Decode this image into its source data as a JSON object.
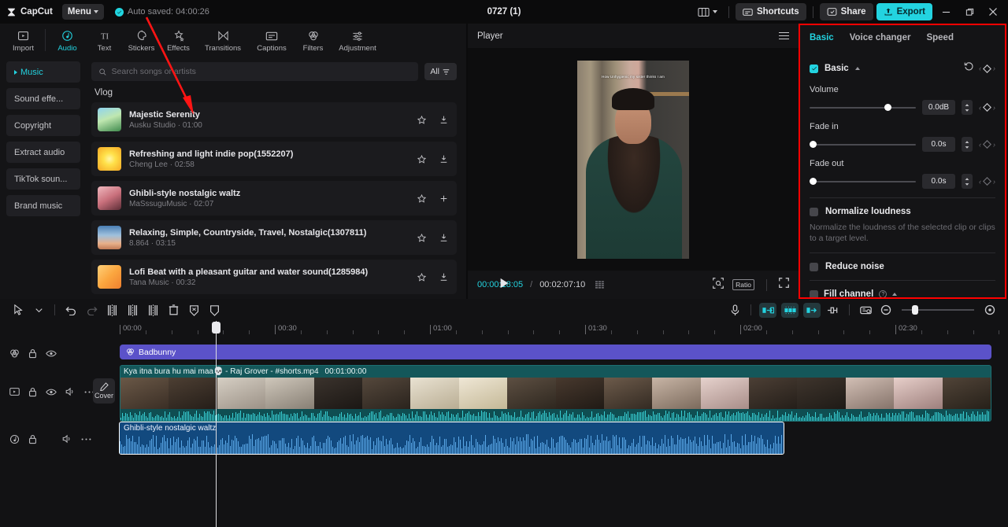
{
  "titlebar": {
    "brand": "CapCut",
    "menu_label": "Menu",
    "autosave": "Auto saved: 04:00:26",
    "project_title": "0727 (1)",
    "shortcuts_label": "Shortcuts",
    "share_label": "Share",
    "export_label": "Export",
    "accent": "#23d3e0"
  },
  "nav_tabs": [
    {
      "label": "Import",
      "icon": "import-icon",
      "active": false
    },
    {
      "label": "Audio",
      "icon": "audio-icon",
      "active": true
    },
    {
      "label": "Text",
      "icon": "text-icon",
      "active": false
    },
    {
      "label": "Stickers",
      "icon": "stickers-icon",
      "active": false
    },
    {
      "label": "Effects",
      "icon": "effects-icon",
      "active": false
    },
    {
      "label": "Transitions",
      "icon": "transitions-icon",
      "active": false
    },
    {
      "label": "Captions",
      "icon": "captions-icon",
      "active": false
    },
    {
      "label": "Filters",
      "icon": "filters-icon",
      "active": false
    },
    {
      "label": "Adjustment",
      "icon": "adjustment-icon",
      "active": false
    }
  ],
  "side_nav": [
    {
      "label": "Music",
      "active": true
    },
    {
      "label": "Sound effe...",
      "active": false
    },
    {
      "label": "Copyright",
      "active": false
    },
    {
      "label": "Extract audio",
      "active": false
    },
    {
      "label": "TikTok soun...",
      "active": false
    },
    {
      "label": "Brand music",
      "active": false
    }
  ],
  "search": {
    "placeholder": "Search songs or artists",
    "value": "",
    "filter_label": "All"
  },
  "music": {
    "section_title": "Vlog",
    "items": [
      {
        "title": "Majestic Serenity",
        "artist": "Ausku Studio",
        "duration": "01:00",
        "action": "download",
        "thumb_a": "#6fb3d9",
        "thumb_b": "#3f8a4d"
      },
      {
        "title": "Refreshing and light indie pop(1552207)",
        "artist": "Cheng Lee",
        "duration": "02:58",
        "action": "download",
        "thumb_a": "#ffe96a",
        "thumb_b": "#f5b324"
      },
      {
        "title": "Ghibli-style nostalgic waltz",
        "artist": "MaSssuguMusic",
        "duration": "02:07",
        "action": "add",
        "thumb_a": "#e4a1a8",
        "thumb_b": "#6d3a42"
      },
      {
        "title": "Relaxing, Simple, Countryside, Travel, Nostalgic(1307811)",
        "artist": "8.864",
        "duration": "03:15",
        "action": "download",
        "thumb_a": "#8fb8dd",
        "thumb_b": "#e0a07a"
      },
      {
        "title": "Lofi Beat with a pleasant guitar and water sound(1285984)",
        "artist": "Tana Music",
        "duration": "00:32",
        "action": "download",
        "thumb_a": "#ffb74d",
        "thumb_b": "#ef7f2e"
      }
    ]
  },
  "player": {
    "title": "Player",
    "caption_overlay": "How Unhygienic my sister thinks I am",
    "current_time": "00:00:18:05",
    "separator": "/",
    "total_time": "00:02:07:10",
    "ratio_label": "Ratio"
  },
  "properties": {
    "tabs": [
      {
        "label": "Basic",
        "active": true
      },
      {
        "label": "Voice changer",
        "active": false
      },
      {
        "label": "Speed",
        "active": false
      }
    ],
    "basic_group": {
      "label": "Basic",
      "enabled": true
    },
    "volume": {
      "label": "Volume",
      "value": "0.0dB",
      "pct": 72
    },
    "fade_in": {
      "label": "Fade in",
      "value": "0.0s",
      "pct": 0
    },
    "fade_out": {
      "label": "Fade out",
      "value": "0.0s",
      "pct": 0
    },
    "normalize": {
      "label": "Normalize loudness",
      "enabled": false,
      "help": "Normalize the loudness of the selected clip or clips to a target level."
    },
    "reduce_noise": {
      "label": "Reduce noise",
      "enabled": false
    },
    "fill_channel": {
      "label": "Fill channel"
    }
  },
  "timeline": {
    "toolbar_icons": [
      "select-tool-icon",
      "chevron-down-icon",
      "undo-icon",
      "redo-icon",
      "split-icon",
      "trim-left-icon",
      "trim-right-icon",
      "delete-icon",
      "freeze-icon",
      "mirror-icon"
    ],
    "right_icons": [
      "microphone-icon",
      "auto-caption-icon",
      "auto-reframe-icon",
      "retouch-icon",
      "keyframe-icon",
      "preview-render-icon",
      "zoom-out-icon",
      "zoom-fit-icon"
    ],
    "ruler_labels": [
      "00:00",
      "00:30",
      "01:00",
      "01:30",
      "02:00",
      "02:30"
    ],
    "playhead_time": "00:00:18:05",
    "cover_label": "Cover",
    "tracks": [
      {
        "type": "text",
        "head_icons": [
          "effects-track-icon",
          "lock-icon",
          "eye-icon"
        ],
        "clip_label": "Badbunny"
      },
      {
        "type": "video",
        "head_icons": [
          "video-track-icon",
          "lock-icon",
          "eye-icon",
          "volume-icon",
          "more-icon"
        ],
        "clip_label": "Kya itna bura hu mai maa💀 - Raj Grover - #shorts.mp4",
        "clip_duration": "00:01:00:00"
      },
      {
        "type": "audio",
        "head_icons": [
          "audio-track-icon",
          "lock-icon",
          "volume-icon",
          "more-icon"
        ],
        "clip_label": "Ghibli-style nostalgic waltz"
      }
    ]
  }
}
